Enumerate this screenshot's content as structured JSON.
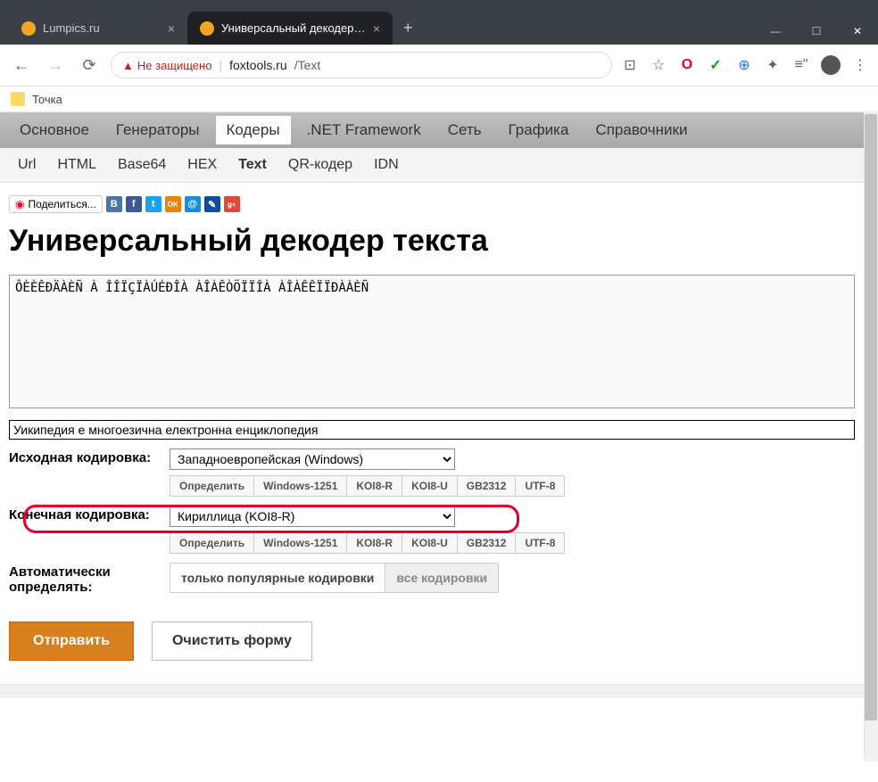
{
  "browser": {
    "tabs": [
      {
        "title": "Lumpics.ru",
        "active": false,
        "favicon": "#f5a623"
      },
      {
        "title": "Универсальный декодер текста",
        "active": true,
        "favicon": "#f5a623"
      }
    ],
    "insecure_label": "Не защищено",
    "url_domain": "foxtools.ru",
    "url_path": "/Text",
    "bookmark": "Точка"
  },
  "nav": {
    "main": [
      "Основное",
      "Генераторы",
      "Кодеры",
      ".NET Framework",
      "Сеть",
      "Графика",
      "Справочники"
    ],
    "main_active": 2,
    "sub": [
      "Url",
      "HTML",
      "Base64",
      "HEX",
      "Text",
      "QR-кодер",
      "IDN"
    ],
    "sub_active": 4
  },
  "share": {
    "button": "Поделиться...",
    "socials": [
      {
        "name": "vk",
        "bg": "#4a76a8",
        "glyph": "B"
      },
      {
        "name": "fb",
        "bg": "#3b5998",
        "glyph": "f"
      },
      {
        "name": "tw",
        "bg": "#1da1f2",
        "glyph": "t"
      },
      {
        "name": "ok",
        "bg": "#ee8208",
        "glyph": "OK"
      },
      {
        "name": "mail",
        "bg": "#168de2",
        "glyph": "@"
      },
      {
        "name": "lj",
        "bg": "#0c4da2",
        "glyph": "✎"
      },
      {
        "name": "gp",
        "bg": "#dd4b39",
        "glyph": "g+"
      }
    ]
  },
  "page": {
    "title": "Универсальный декодер текста",
    "input_text": "ÔÈÈÊÐÄÀÈÑ À ÎÎÏÇÏÀÚÉÐÎÀ ÀÎÀÊÒÖÏÏÎÀ ÀÎÀÊÊÏÏÐÀÀÈÑ",
    "output_text": "Уикипедия е многоезична електронна енциклопедия"
  },
  "form": {
    "source_label": "Исходная кодировка:",
    "source_value": "Западноевропейская (Windows)",
    "target_label": "Конечная кодировка:",
    "target_value": "Кириллица (KOI8-R)",
    "auto_label": "Автоматически определять:",
    "encoding_buttons": [
      "Определить",
      "Windows-1251",
      "KOI8-R",
      "KOI8-U",
      "GB2312",
      "UTF-8"
    ],
    "mode_popular": "только популярные кодировки",
    "mode_all": "все кодировки",
    "submit": "Отправить",
    "clear": "Очистить форму"
  }
}
